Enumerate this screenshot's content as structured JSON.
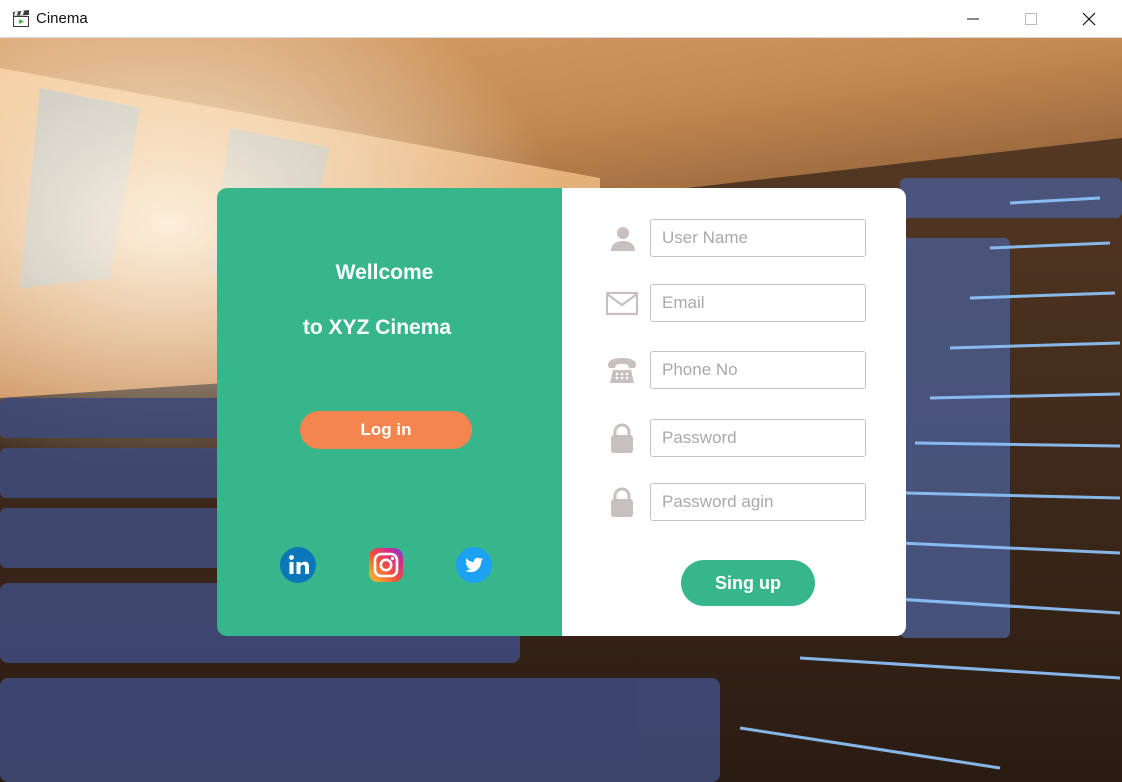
{
  "window": {
    "title": "Cinema",
    "app_icon": "clapperboard-icon",
    "controls": [
      "minimize-icon",
      "maximize-icon",
      "close-icon"
    ]
  },
  "welcome": {
    "line1": "Wellcome",
    "line2": "to XYZ Cinema",
    "login_label": "Log in",
    "social": [
      "linkedin-icon",
      "instagram-icon",
      "twitter-icon"
    ]
  },
  "form": {
    "username": {
      "placeholder": "User Name",
      "icon": "user-icon"
    },
    "email": {
      "placeholder": "Email",
      "icon": "envelope-icon"
    },
    "phone": {
      "placeholder": "Phone No",
      "icon": "telephone-icon"
    },
    "password": {
      "placeholder": "Password",
      "icon": "lock-icon"
    },
    "password_again": {
      "placeholder": "Password agin",
      "icon": "lock-icon"
    },
    "signup_label": "Sing up"
  },
  "colors": {
    "green": "#38b68b",
    "orange": "#f4854e",
    "icon_gray": "#c8bfbf"
  }
}
